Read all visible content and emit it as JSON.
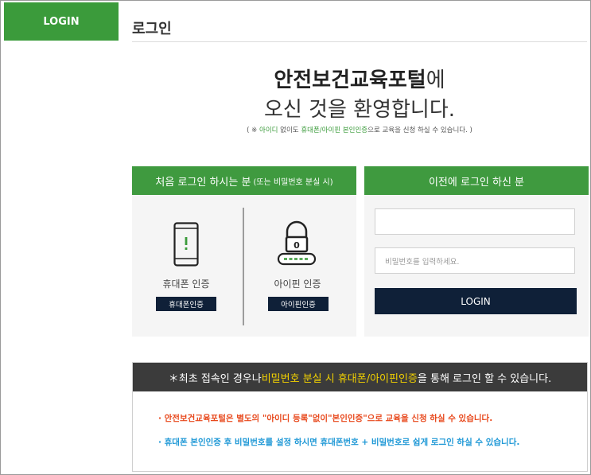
{
  "sidebar": {
    "login_label": "LOGIN"
  },
  "page": {
    "title": "로그인",
    "welcome_strong": "안전보건교육포털",
    "welcome_suffix": "에",
    "welcome_line2": "오신 것을 환영합니다.",
    "notice": {
      "prefix": "( ※ ",
      "id_text": "아이디",
      "mid": " 없이도 ",
      "cert_text": "휴대폰/아이핀 본인인증",
      "suffix": "으로 교육을 신청 하실 수 있습니다. )"
    }
  },
  "first_login": {
    "header_main": "처음 로그인 하시는 분",
    "header_sub": "(또는 비밀번호 분실 시)",
    "phone_label": "휴대폰 인증",
    "phone_button": "휴대폰인증",
    "ipin_label": "아이핀 인증",
    "ipin_button": "아이핀인증",
    "lock_digit": "0"
  },
  "prev_login": {
    "header": "이전에 로그인 하신 분",
    "id_value": "",
    "pw_placeholder": "비밀번호를 입력하세요.",
    "login_button": "LOGIN"
  },
  "info": {
    "header_prefix": "＊최초 접속인 경우나 ",
    "header_highlight": "비밀번호 분실 시 휴대폰/아이핀인증",
    "header_suffix": "을 통해 로그인 할 수 있습니다.",
    "line1": "· 안전보건교육포털은 별도의 \"아이디 등록\"없이\"본인인증\"으로 교육을 신청 하실 수 있습니다.",
    "line2": "· 휴대폰 본인인증 후 비밀번호를 설정 하시면 휴대폰번호 + 비밀번호로 쉽게 로그인 하실 수 있습니다."
  },
  "colors": {
    "brand_green": "#3b9b3b",
    "navy": "#0f2038",
    "info_red": "#e8491d",
    "info_blue": "#1e98d6",
    "highlight_yellow": "#f2d100"
  },
  "icons": [
    "phone-icon",
    "lock-icon"
  ]
}
